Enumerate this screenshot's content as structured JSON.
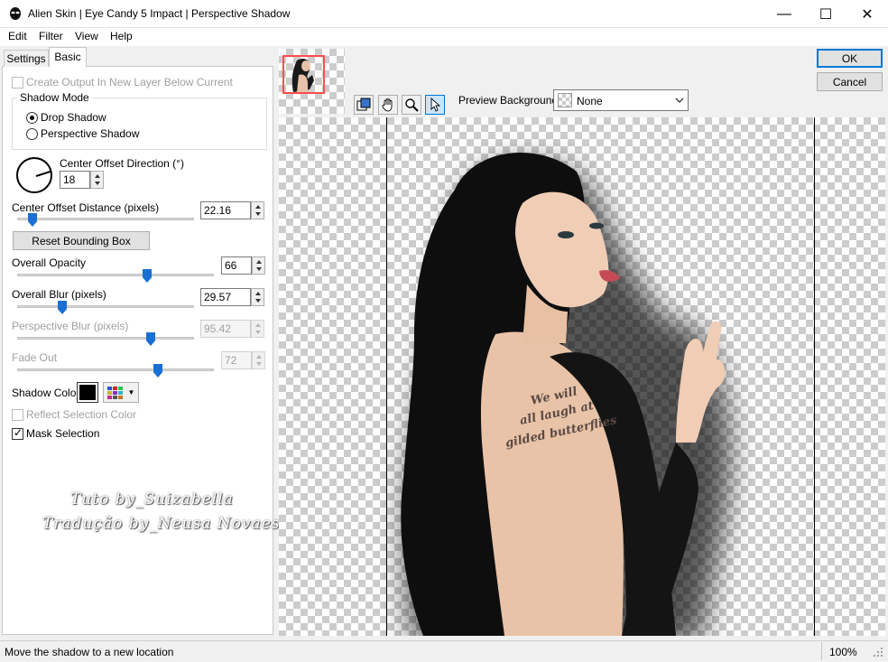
{
  "window": {
    "title": "Alien Skin | Eye Candy 5 Impact | Perspective Shadow",
    "minimize_glyph": "—",
    "maximize_glyph": "☐",
    "close_glyph": "✕"
  },
  "menu": [
    "Edit",
    "Filter",
    "View",
    "Help"
  ],
  "tabs": {
    "settings": "Settings",
    "basic": "Basic"
  },
  "basic": {
    "create_output_label": "Create Output In New Layer Below Current",
    "create_output_checked": false,
    "shadow_mode": {
      "title": "Shadow Mode",
      "options": [
        "Drop Shadow",
        "Perspective Shadow"
      ],
      "selected": "Drop Shadow"
    },
    "center_offset_direction": {
      "label": "Center Offset Direction (°)",
      "value": "18"
    },
    "center_offset_distance": {
      "label": "Center Offset Distance (pixels)",
      "value": "22.16"
    },
    "reset_bounding_box": "Reset Bounding Box",
    "overall_opacity": {
      "label": "Overall Opacity",
      "value": "66"
    },
    "overall_blur": {
      "label": "Overall Blur (pixels)",
      "value": "29.57"
    },
    "perspective_blur": {
      "label": "Perspective Blur (pixels)",
      "value": "95.42"
    },
    "fade_out": {
      "label": "Fade Out",
      "value": "72"
    },
    "shadow_color": {
      "label": "Shadow Color",
      "value": "#000000"
    },
    "reflect_selection_color": {
      "label": "Reflect Selection Color",
      "checked": false
    },
    "mask_selection": {
      "label": "Mask Selection",
      "checked": true
    }
  },
  "watermark": {
    "line1": "Tuto by_Suizabella",
    "line2": "Tradução by_Neusa Novaes"
  },
  "buttons": {
    "ok": "OK",
    "cancel": "Cancel"
  },
  "preview": {
    "background_label": "Preview Background:",
    "background_value": "None",
    "tattoo_line1": "We will",
    "tattoo_line2": "all laugh at",
    "tattoo_line3": "gilded butterflies"
  },
  "tools": [
    "navigator-icon",
    "hand-icon",
    "zoom-icon",
    "pointer-icon"
  ],
  "status": {
    "message": "Move the shadow to a new location",
    "zoom": "100%"
  }
}
